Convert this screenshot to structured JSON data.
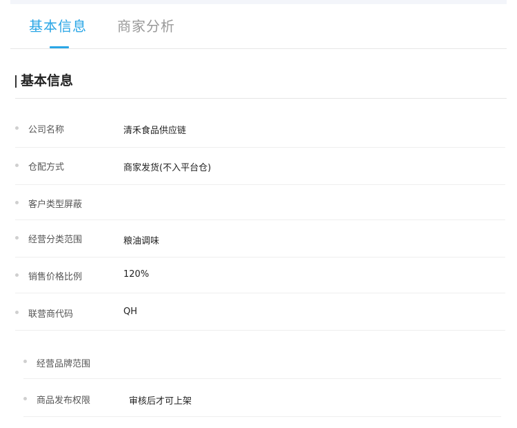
{
  "tabs": [
    {
      "label": "基本信息",
      "active": true
    },
    {
      "label": "商家分析",
      "active": false
    }
  ],
  "section": {
    "title": "基本信息"
  },
  "fields": [
    {
      "label": "公司名称",
      "value": "清禾食品供应链"
    },
    {
      "label": "仓配方式",
      "value": "商家发货(不入平台仓)"
    },
    {
      "label": "客户类型屏蔽",
      "value": ""
    },
    {
      "label": "经营分类范围",
      "value": "粮油调味"
    },
    {
      "label": "销售价格比例",
      "value": "120%"
    },
    {
      "label": "联营商代码",
      "value": "QH"
    }
  ],
  "sub_fields": [
    {
      "label": "经营品牌范围",
      "value": ""
    },
    {
      "label": "商品发布权限",
      "value": "审核后才可上架"
    }
  ],
  "colors": {
    "accent": "#2aa6e6",
    "inactive_tab": "#999999",
    "divider": "#eeeeee"
  }
}
